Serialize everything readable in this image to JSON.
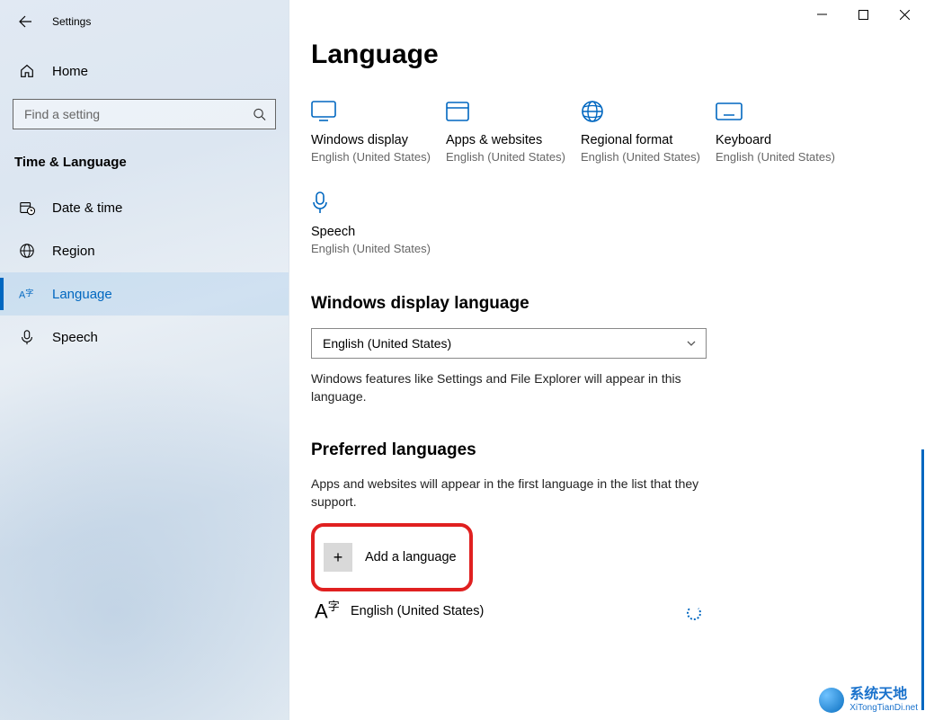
{
  "app_title": "Settings",
  "home_label": "Home",
  "search_placeholder": "Find a setting",
  "section_header": "Time & Language",
  "nav": [
    {
      "key": "datetime",
      "label": "Date & time"
    },
    {
      "key": "region",
      "label": "Region"
    },
    {
      "key": "language",
      "label": "Language"
    },
    {
      "key": "speech",
      "label": "Speech"
    }
  ],
  "page_title": "Language",
  "tiles": [
    {
      "key": "display",
      "label": "Windows display",
      "sub": "English (United States)"
    },
    {
      "key": "apps",
      "label": "Apps & websites",
      "sub": "English (United States)"
    },
    {
      "key": "regional",
      "label": "Regional format",
      "sub": "English (United States)"
    },
    {
      "key": "keyboard",
      "label": "Keyboard",
      "sub": "English (United States)"
    },
    {
      "key": "speech",
      "label": "Speech",
      "sub": "English (United States)"
    }
  ],
  "display_lang": {
    "title": "Windows display language",
    "selected": "English (United States)",
    "hint": "Windows features like Settings and File Explorer will appear in this language."
  },
  "preferred": {
    "title": "Preferred languages",
    "hint": "Apps and websites will appear in the first language in the list that they support.",
    "add_label": "Add a language",
    "items": [
      {
        "name": "English (United States)"
      }
    ]
  },
  "watermark": {
    "title": "系统天地",
    "sub": "XiTongTianDi.net"
  }
}
